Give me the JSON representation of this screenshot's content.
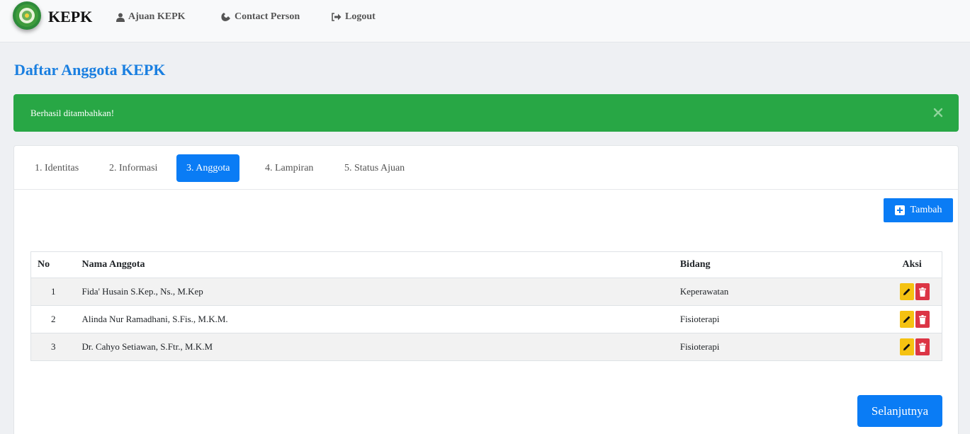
{
  "navbar": {
    "brand": "KEPK",
    "links": [
      {
        "label": "Ajuan KEPK",
        "icon": "user-icon"
      },
      {
        "label": "Contact Person",
        "icon": "phone-icon"
      },
      {
        "label": "Logout",
        "icon": "sign-out-icon"
      }
    ]
  },
  "page": {
    "title": "Daftar Anggota KEPK"
  },
  "alert": {
    "message": "Berhasil ditambahkan!",
    "color": "#28a745"
  },
  "tabs": [
    {
      "label": "1. Identitas",
      "active": false
    },
    {
      "label": "2. Informasi",
      "active": false
    },
    {
      "label": "3. Anggota",
      "active": true
    },
    {
      "label": "4. Lampiran",
      "active": false
    },
    {
      "label": "5. Status Ajuan",
      "active": false
    }
  ],
  "toolbar": {
    "add_label": "Tambah"
  },
  "table": {
    "headers": [
      "No",
      "Nama Anggota",
      "Bidang",
      "Aksi"
    ],
    "rows": [
      {
        "no": "1",
        "nama": "Fida' Husain S.Kep., Ns., M.Kep",
        "bidang": "Keperawatan"
      },
      {
        "no": "2",
        "nama": "Alinda Nur Ramadhani, S.Fis., M.K.M.",
        "bidang": "Fisioterapi"
      },
      {
        "no": "3",
        "nama": "Dr. Cahyo Setiawan, S.Ftr., M.K.M",
        "bidang": "Fisioterapi"
      }
    ]
  },
  "footer": {
    "next_label": "Selanjutnya"
  },
  "colors": {
    "primary": "#0a7cf5",
    "title": "#1a7fe0",
    "edit": "#f5c211",
    "delete": "#dc3545"
  }
}
